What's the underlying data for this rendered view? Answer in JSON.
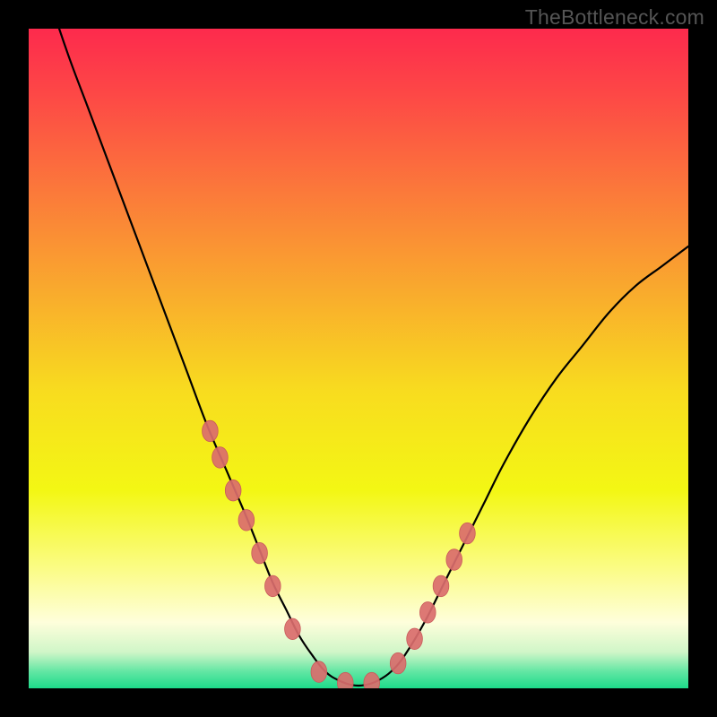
{
  "watermark": "TheBottleneck.com",
  "colors": {
    "frame": "#000000",
    "curve": "#000000",
    "marker_fill": "#da6d6d",
    "marker_stroke": "#c95a5a",
    "gradient_stops": [
      {
        "offset": 0.0,
        "color": "#fd2a4d"
      },
      {
        "offset": 0.1,
        "color": "#fd4846"
      },
      {
        "offset": 0.25,
        "color": "#fb7a3a"
      },
      {
        "offset": 0.4,
        "color": "#f9ab2d"
      },
      {
        "offset": 0.55,
        "color": "#f8dc1f"
      },
      {
        "offset": 0.7,
        "color": "#f3f714"
      },
      {
        "offset": 0.82,
        "color": "#fbfc87"
      },
      {
        "offset": 0.9,
        "color": "#fefedb"
      },
      {
        "offset": 0.945,
        "color": "#d0f6c8"
      },
      {
        "offset": 0.975,
        "color": "#61e6a3"
      },
      {
        "offset": 1.0,
        "color": "#1ddb8a"
      }
    ]
  },
  "chart_data": {
    "type": "line",
    "title": "",
    "xlabel": "",
    "ylabel": "",
    "xlim": [
      0,
      100
    ],
    "ylim": [
      0,
      100
    ],
    "grid": false,
    "series": [
      {
        "name": "curve",
        "x": [
          0,
          3,
          6,
          9,
          12,
          15,
          18,
          21,
          24,
          27,
          30,
          33,
          35,
          37,
          39,
          41,
          43,
          45,
          47,
          49,
          51,
          53,
          55,
          57,
          60,
          63,
          66,
          69,
          72,
          76,
          80,
          84,
          88,
          92,
          96,
          100
        ],
        "values": [
          115,
          105,
          96,
          88,
          80,
          72,
          64,
          56,
          48,
          40,
          33,
          26,
          21,
          16,
          12,
          8,
          5,
          2.5,
          1.2,
          0.5,
          0.5,
          1.2,
          2.6,
          5,
          10,
          16,
          22,
          28,
          34,
          41,
          47,
          52,
          57,
          61,
          64,
          67
        ]
      }
    ],
    "markers": {
      "name": "points",
      "x": [
        27.5,
        29,
        31,
        33,
        35,
        37,
        40,
        44,
        48,
        52,
        56,
        58.5,
        60.5,
        62.5,
        64.5,
        66.5
      ],
      "values": [
        39,
        35,
        30,
        25.5,
        20.5,
        15.5,
        9,
        2.5,
        0.8,
        0.8,
        3.8,
        7.5,
        11.5,
        15.5,
        19.5,
        23.5
      ],
      "rx": 1.2,
      "ry": 1.6
    }
  }
}
